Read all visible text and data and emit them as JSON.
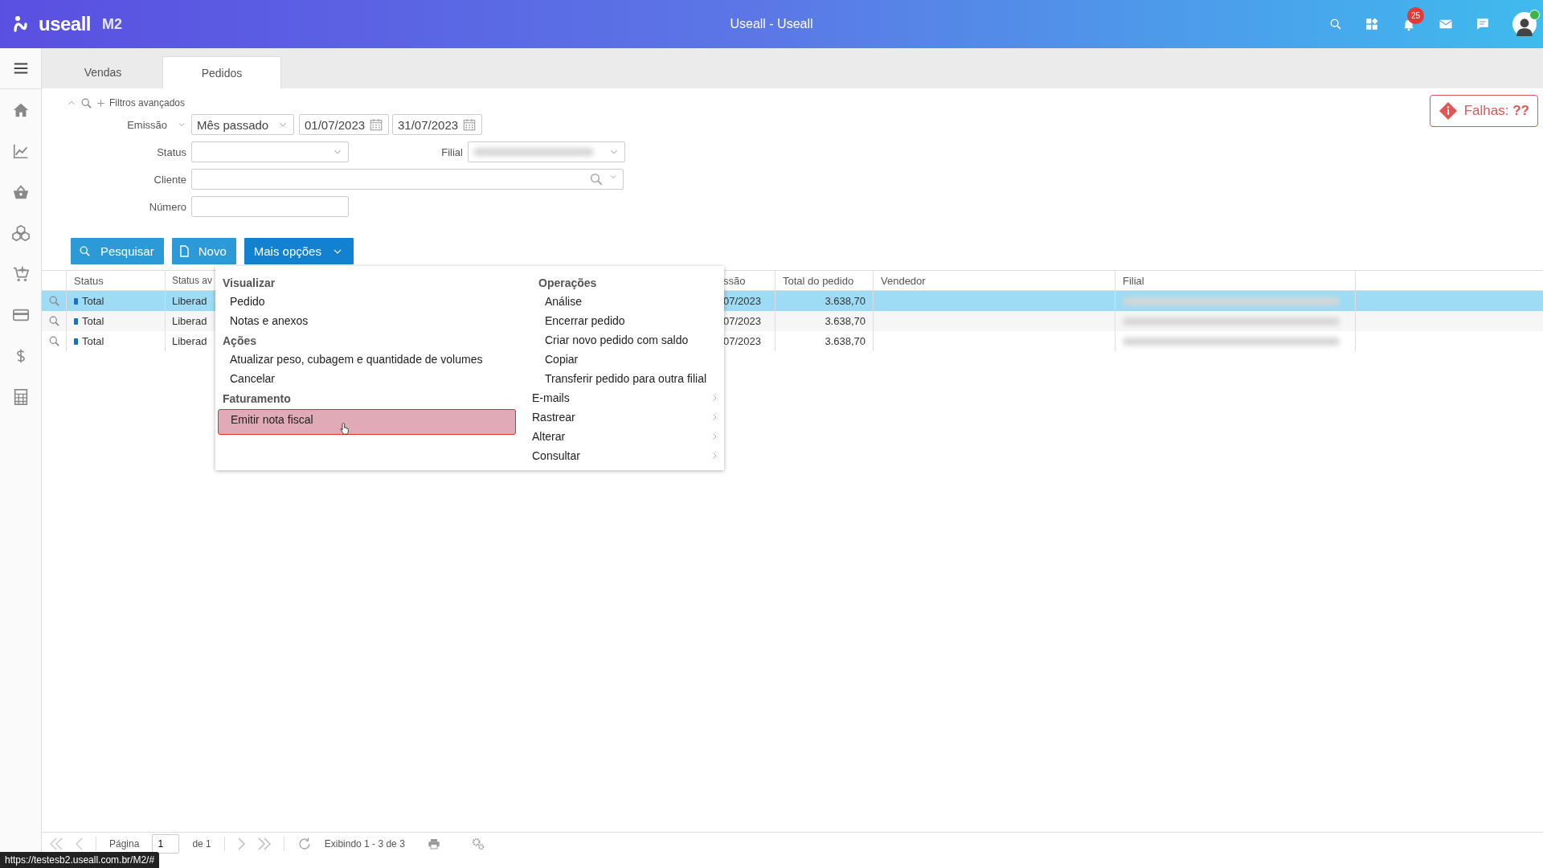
{
  "header": {
    "logo": "useall",
    "product": "M2",
    "title": "Useall - Useall",
    "notifications": "25"
  },
  "tabs": [
    {
      "label": "Vendas",
      "selected": false
    },
    {
      "label": "Pedidos",
      "selected": true
    }
  ],
  "filters": {
    "advanced": "Filtros avançados",
    "emissao": {
      "label": "Emissão",
      "period": "Mês passado",
      "from": "01/07/2023",
      "to": "31/07/2023"
    },
    "status": {
      "label": "Status"
    },
    "filial": {
      "label": "Filial"
    },
    "cliente": {
      "label": "Cliente"
    },
    "numero": {
      "label": "Número"
    }
  },
  "buttons": [
    {
      "label": "Pesquisar",
      "kind": "search"
    },
    {
      "label": "Novo",
      "kind": "new"
    },
    {
      "label": "Mais opções",
      "kind": "dropdown"
    }
  ],
  "alert": {
    "label": "Falhas: ",
    "value": "??"
  },
  "table": {
    "columns": [
      "Status",
      "Status av",
      "ssão",
      "Total do pedido",
      "Vendedor",
      "Filial"
    ],
    "rows": [
      {
        "selected": true,
        "cells": [
          "Total",
          "Liberad",
          "07/2023",
          "3.638,70"
        ]
      },
      {
        "selected": false,
        "cells": [
          "Total",
          "Liberad",
          "07/2023",
          "3.638,70"
        ]
      },
      {
        "selected": false,
        "cells": [
          "Total",
          "Liberad",
          "07/2023",
          "3.638,70"
        ]
      }
    ]
  },
  "menu": {
    "columns": [
      [
        {
          "kind": "heading",
          "label": "Visualizar"
        },
        {
          "kind": "item",
          "label": "Pedido",
          "highlighted": false
        },
        {
          "kind": "item",
          "label": "Notas e anexos",
          "highlighted": false
        },
        {
          "kind": "heading",
          "label": "Ações"
        },
        {
          "kind": "item",
          "label": "Atualizar peso, cubagem e quantidade de volumes",
          "highlighted": false
        },
        {
          "kind": "item",
          "label": "Cancelar",
          "highlighted": false
        },
        {
          "kind": "heading",
          "label": "Faturamento"
        },
        {
          "kind": "item",
          "label": "Emitir nota fiscal",
          "highlighted": true
        }
      ],
      [
        {
          "kind": "heading",
          "label": "Operações"
        },
        {
          "kind": "item",
          "label": "Análise",
          "highlighted": false
        },
        {
          "kind": "item",
          "label": "Encerrar pedido",
          "highlighted": false
        },
        {
          "kind": "item",
          "label": "Criar novo pedido com saldo",
          "highlighted": false
        },
        {
          "kind": "item",
          "label": "Copiar",
          "highlighted": false
        },
        {
          "kind": "item",
          "label": "Transferir pedido para outra filial",
          "highlighted": false
        },
        {
          "kind": "submenu",
          "label": "E-mails"
        },
        {
          "kind": "submenu",
          "label": "Rastrear"
        },
        {
          "kind": "submenu",
          "label": "Alterar"
        },
        {
          "kind": "submenu",
          "label": "Consultar"
        }
      ]
    ]
  },
  "pager": {
    "page_label": "Página",
    "page": "1",
    "of": "de 1",
    "summary": "Exibindo 1 - 3 de 3"
  },
  "status_url": "https://testesb2.useall.com.br/M2/#"
}
